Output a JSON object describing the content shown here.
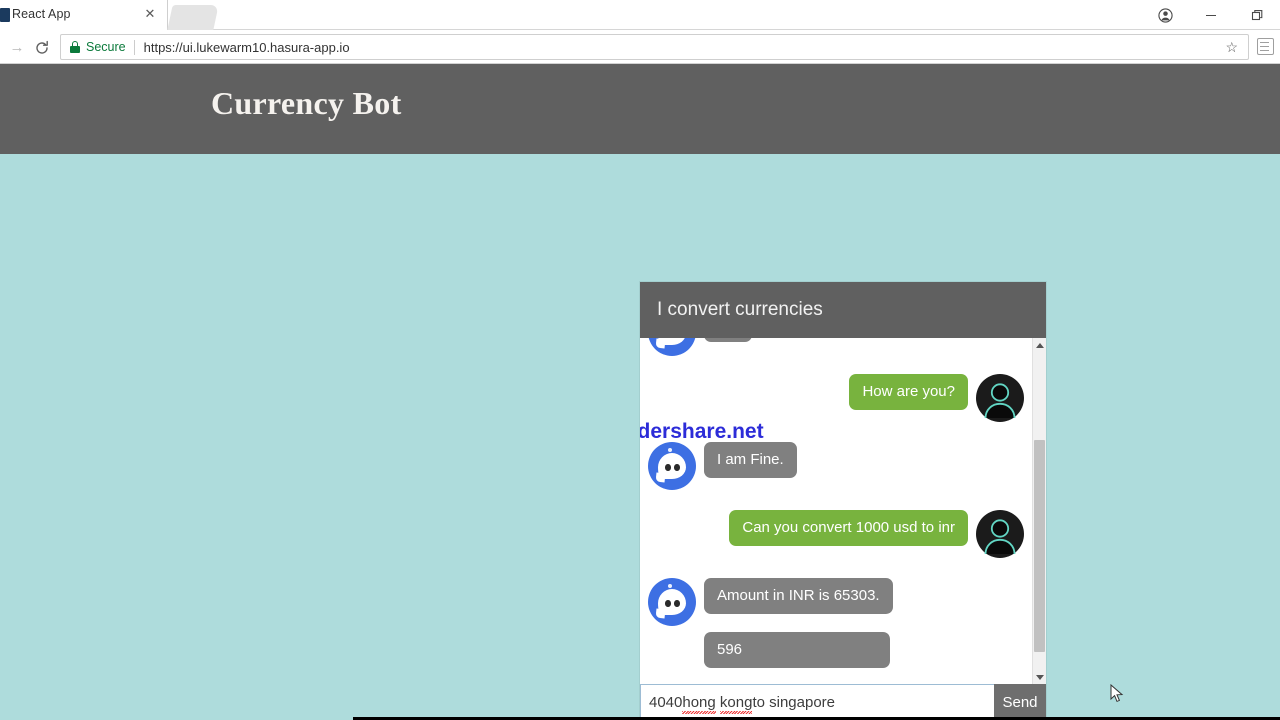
{
  "browser": {
    "tab": {
      "title": "React App",
      "close_label": "✕"
    },
    "window_controls": {
      "profile": "profile-icon",
      "minimize": "–",
      "maximize": "maximize-icon"
    },
    "toolbar": {
      "forward": "→",
      "reload": "reload-icon",
      "security_label": "Secure",
      "url": "https://ui.lukewarm10.hasura-app.io",
      "bookmark": "☆",
      "extension": "extension-icon"
    }
  },
  "site": {
    "title": "Currency Bot",
    "background_color": "#aedcdc",
    "header_color": "#606060"
  },
  "watermark": {
    "text": "www.thundershare.net",
    "color": "#2c2cd8"
  },
  "chat": {
    "header_title": "I convert currencies",
    "bot_bubble_color": "#808080",
    "user_bubble_color": "#78b33e",
    "messages": [
      {
        "sender": "bot",
        "text": "",
        "clipped": true
      },
      {
        "sender": "user",
        "text": "How are you?"
      },
      {
        "sender": "bot",
        "text": "I am Fine."
      },
      {
        "sender": "user",
        "text": "Can you convert 1000 usd to inr"
      },
      {
        "sender": "bot",
        "text": "Amount in INR is 65303."
      },
      {
        "sender": "bot",
        "text": "596",
        "continuation": true
      }
    ],
    "input": {
      "value": "4040 hong kong to singapore",
      "placeholder": "",
      "spellcheck_words": [
        "hong",
        "kong"
      ],
      "value_prefix": "4040 ",
      "value_suffix": " to singapore"
    },
    "send_label": "Send"
  }
}
